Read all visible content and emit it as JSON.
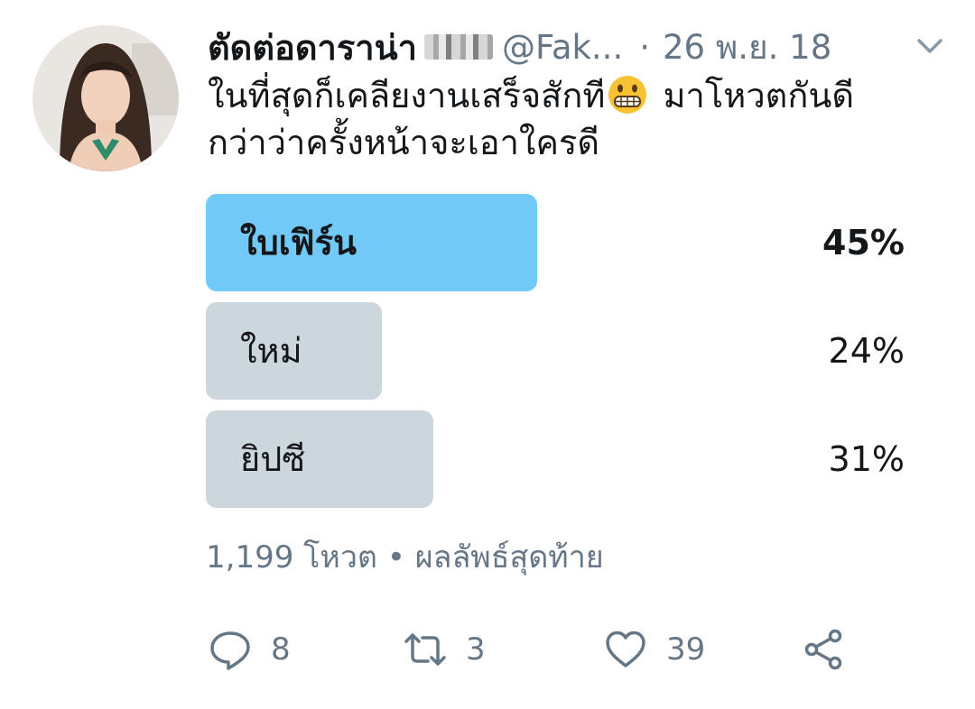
{
  "tweet": {
    "display_name": "ตัดต่อดาราน่า",
    "handle": "@Fak...",
    "separator": "·",
    "date": "26 พ.ย. 18",
    "text_line1_a": "ในที่สุดก็เคลียงานเสร็จสักที",
    "text_line1_b": " มาโหวตกันดี",
    "text_line2": "กว่าว่าครั้งหน้าจะเอาใครดี"
  },
  "poll": {
    "choices": [
      {
        "label": "ใบเฟิร์น",
        "percent_text": "45%",
        "percent": 45,
        "winner": true
      },
      {
        "label": "ใหม่",
        "percent_text": "24%",
        "percent": 24,
        "winner": false
      },
      {
        "label": "ยิปซี",
        "percent_text": "31%",
        "percent": 31,
        "winner": false
      }
    ],
    "votes_text": "1,199 โหวต",
    "bullet": "•",
    "status_text": "ผลลัพธ์สุดท้าย"
  },
  "actions": {
    "reply_count": "8",
    "retweet_count": "3",
    "like_count": "39"
  },
  "colors": {
    "winner_bar": "#71c9f8",
    "other_bar": "#ccd6dd",
    "secondary_text": "#657786"
  },
  "icons": [
    "avatar",
    "blurred-name-icon",
    "chevron-down-icon",
    "grimacing-emoji-icon",
    "reply-icon",
    "retweet-icon",
    "heart-icon",
    "share-icon"
  ]
}
